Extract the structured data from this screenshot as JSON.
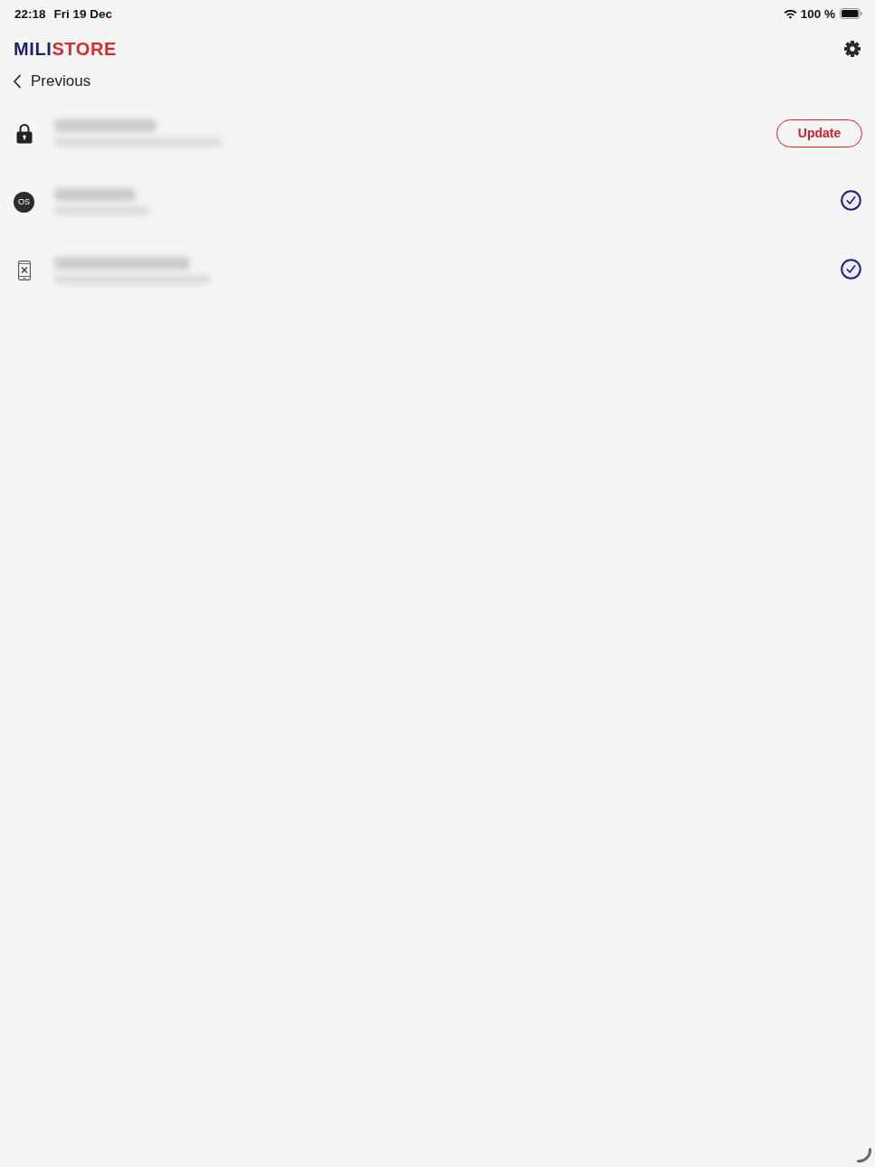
{
  "status_bar": {
    "time": "22:18",
    "date": "Fri 19 Dec",
    "battery": "100 %"
  },
  "header": {
    "logo": [
      {
        "text": "MILI",
        "color": "#1c2270"
      },
      {
        "text": "STORE",
        "color": "#d62b2b"
      }
    ]
  },
  "back": {
    "label": "Previous"
  },
  "items": [
    {
      "status": {
        "kind": "button",
        "label": "Update"
      }
    },
    {
      "badge": "OS",
      "status": {
        "kind": "check"
      }
    },
    {
      "status": {
        "kind": "check"
      }
    }
  ]
}
